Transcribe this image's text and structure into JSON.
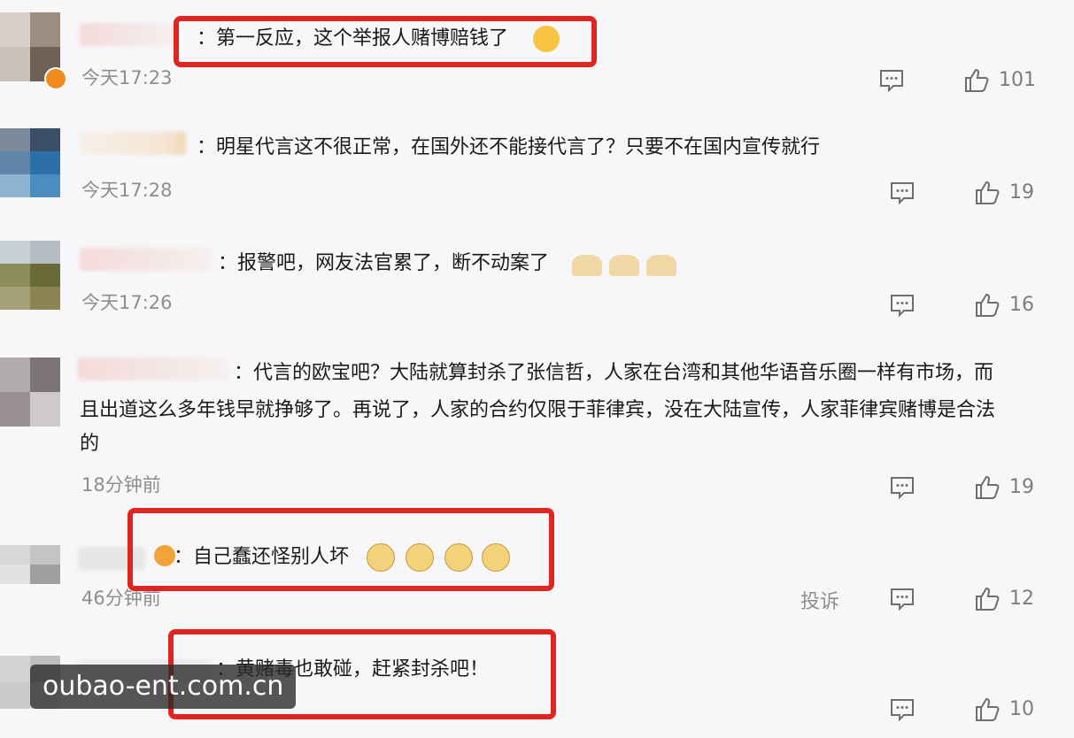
{
  "comments": [
    {
      "text": "：第一反应，这个举报人赌博赔钱了",
      "time": "今天17:23",
      "likes": "101"
    },
    {
      "text": "：明星代言这不很正常，在国外还不能接代言了？只要不在国内宣传就行",
      "time": "今天17:28",
      "likes": "19"
    },
    {
      "text": "：报警吧，网友法官累了，断不动案了",
      "time": "今天17:26",
      "likes": "16"
    },
    {
      "text_line1": "：代言的欧宝吧？大陆就算封杀了张信哲，人家在台湾和其他华语音乐圈一样有市场，而",
      "text_line2": "且出道这么多年钱早就挣够了。再说了，人家的合约仅限于菲律宾，没在大陆宣传，人家菲律宾赌博是合法",
      "text_line3": "的",
      "time": "18分钟前",
      "likes": "19"
    },
    {
      "text": "：自己蠢还怪别人坏",
      "time": "46分钟前",
      "report": "投诉",
      "likes": "12"
    },
    {
      "text": "：黄赌毒也敢碰，赶紧封杀吧！",
      "likes": "10"
    }
  ],
  "watermark": "oubao-ent.com.cn",
  "colors": {
    "highlight_box": "#e0241f",
    "background": "#f7f6f9",
    "meta_text": "#8e8e8e"
  },
  "icons": {
    "comment": "comment-bubble-icon",
    "like": "thumbs-up-icon",
    "verified": "verified-badge-icon"
  }
}
